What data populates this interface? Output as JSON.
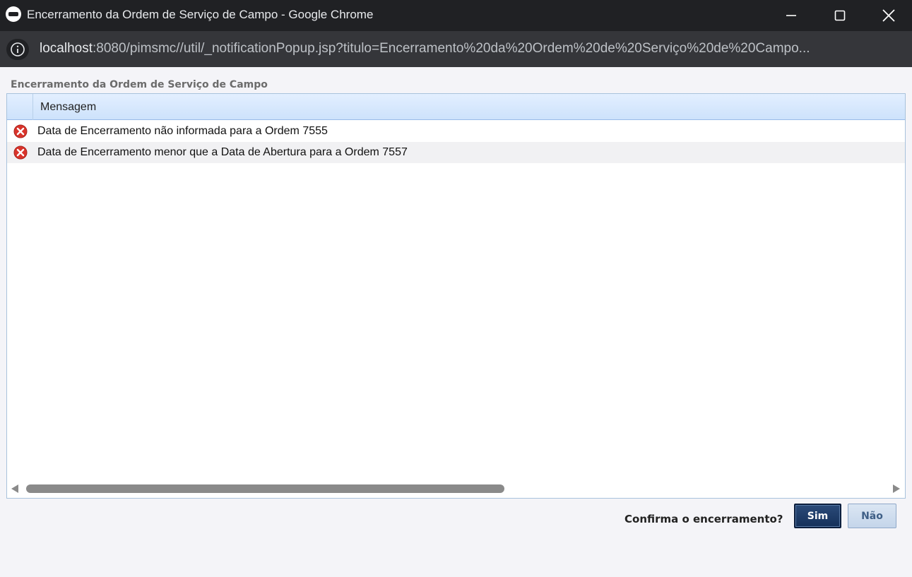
{
  "window": {
    "title": "Encerramento da Ordem de Serviço de Campo - Google Chrome"
  },
  "addressbar": {
    "url_host": "localhost",
    "url_rest": ":8080/pimsmc//util/_notificationPopup.jsp?titulo=Encerramento%20da%20Ordem%20de%20Serviço%20de%20Campo..."
  },
  "panel": {
    "title": "Encerramento da Ordem de Serviço de Campo"
  },
  "grid": {
    "columns": [
      "",
      "Mensagem"
    ],
    "rows": [
      {
        "icon": "error-icon",
        "message": "Data de Encerramento não informada para a Ordem 7555"
      },
      {
        "icon": "error-icon",
        "message": "Data de Encerramento menor que a Data de Abertura para a Ordem 7557"
      }
    ]
  },
  "footer": {
    "question": "Confirma o encerramento?",
    "yes_label": "Sim",
    "no_label": "Não"
  },
  "colors": {
    "error": "#d9342b",
    "header_bg": "#cde2fb",
    "primary_button": "#15305a"
  }
}
